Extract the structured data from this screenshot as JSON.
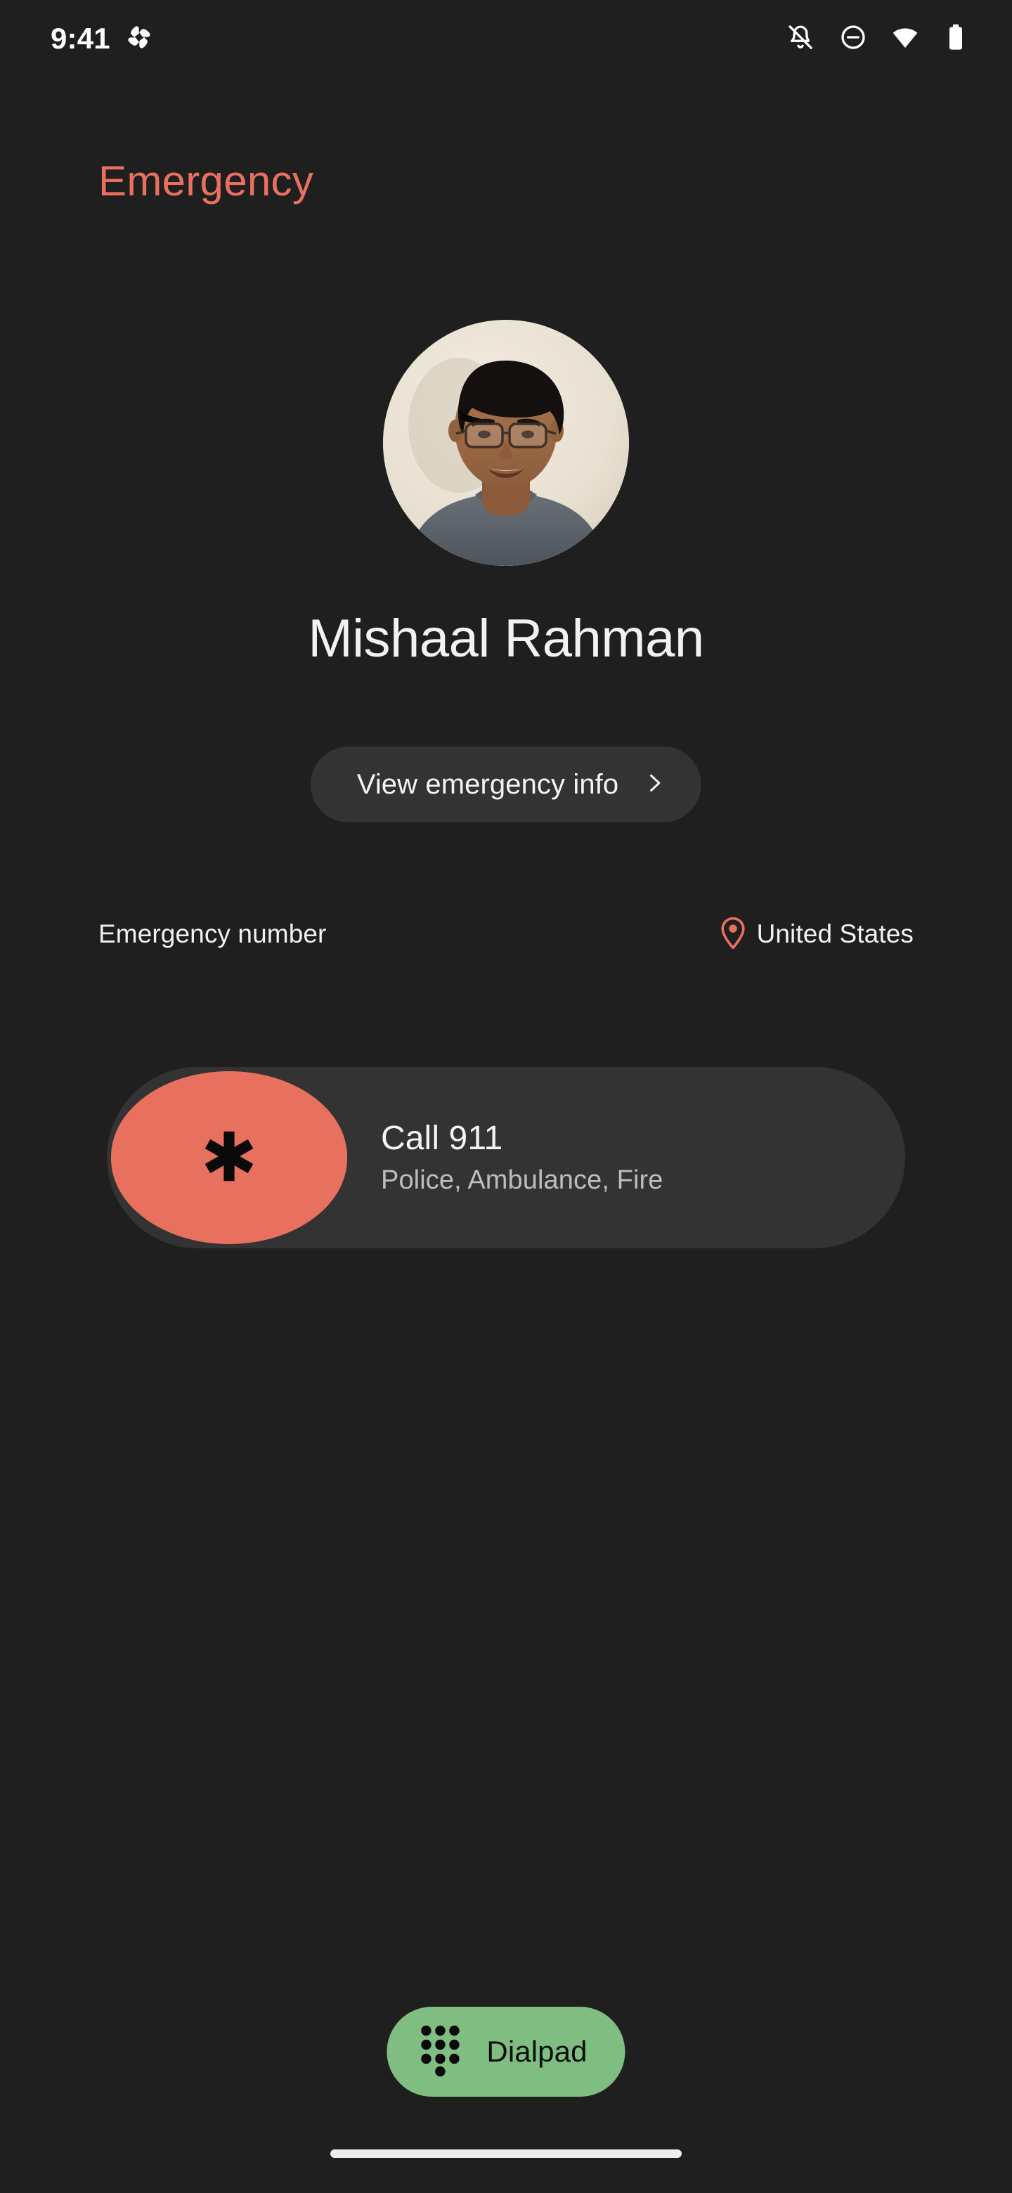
{
  "status_bar": {
    "time": "9:41",
    "left_icons": [
      {
        "name": "clover-app-icon",
        "label": "clover"
      }
    ],
    "right_icons": [
      {
        "name": "notifications-off-icon",
        "label": "Notifications silenced"
      },
      {
        "name": "do-not-disturb-icon",
        "label": "Do not disturb"
      },
      {
        "name": "wifi-icon",
        "label": "Wi-Fi connected"
      },
      {
        "name": "battery-full-icon",
        "label": "Battery full"
      }
    ]
  },
  "screen": {
    "title": "Emergency"
  },
  "owner": {
    "name": "Mishaal Rahman",
    "avatar_alt": "Profile photo of Mishaal Rahman",
    "info_button_label": "View emergency info",
    "info_button_chevron": "chevron-right-icon"
  },
  "emergency_number_section": {
    "label": "Emergency number",
    "region_icon": "location-pin-icon",
    "region": "United States",
    "entries": [
      {
        "badge_icon": "asterisk-emergency-icon",
        "title": "Call 911",
        "subtitle": "Police, Ambulance, Fire"
      }
    ]
  },
  "bottom_bar": {
    "dialpad_icon": "dialpad-dots-icon",
    "dialpad_label": "Dialpad"
  },
  "colors": {
    "background": "#1f1f1f",
    "surface": "#333333",
    "accent_coral": "#e8705f",
    "accent_green": "#7fbe80",
    "text_primary": "#f2f2f2",
    "text_secondary": "#bdbdbd"
  }
}
